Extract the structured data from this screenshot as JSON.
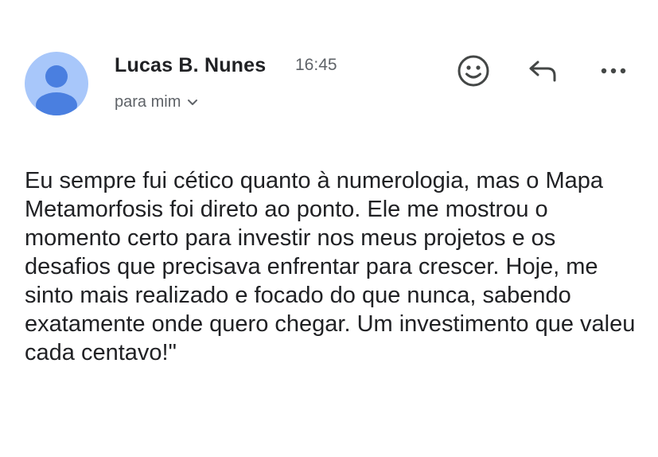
{
  "message": {
    "sender_name": "Lucas B. Nunes",
    "time": "16:45",
    "recipient_label": "para mim",
    "body": "Eu sempre fui cético quanto à numerologia, mas o Mapa Metamorfosis foi direto ao ponto. Ele me mostrou o momento certo para investir nos meus projetos e os desafios que precisava enfrentar para crescer. Hoje, me sinto mais realizado e focado do que nunca, sabendo exatamente onde quero chegar. Um investimento que valeu cada centavo!\""
  },
  "icons": {
    "avatar": "person-avatar-icon",
    "recipient_expand": "chevron-down-icon",
    "emoji": "emoji-reaction-icon",
    "reply": "reply-icon",
    "more": "more-options-icon"
  },
  "colors": {
    "avatar_bg": "#a8c7fa",
    "avatar_figure": "#4a7fe0",
    "text_primary": "#202124",
    "text_secondary": "#5f6368",
    "icon": "#444746"
  }
}
